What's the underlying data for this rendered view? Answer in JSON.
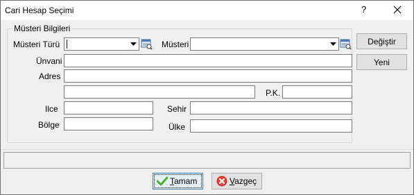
{
  "window": {
    "title": "Cari Hesap Seçimi",
    "help_glyph": "?"
  },
  "group": {
    "title": "Müsteri Bilgileri"
  },
  "fields": {
    "musteri_turu": {
      "label": "Müsteri Türü",
      "value": ""
    },
    "musteri": {
      "label": "Müsteri",
      "value": ""
    },
    "unvani": {
      "label": "Ünvani",
      "value": ""
    },
    "adres": {
      "label": "Adres",
      "value": ""
    },
    "adres2": {
      "value": ""
    },
    "pk": {
      "label": "P.K.",
      "value": ""
    },
    "ilce": {
      "label": "Ilce",
      "value": ""
    },
    "sehir": {
      "label": "Sehir",
      "value": ""
    },
    "bolge": {
      "label": "Bölge",
      "value": ""
    },
    "ulke": {
      "label": "Ülke",
      "value": ""
    }
  },
  "side_buttons": {
    "degistir": "Değiştir",
    "yeni": "Yeni"
  },
  "footer": {
    "ok": {
      "mnemonic": "T",
      "rest": "amam"
    },
    "cancel": {
      "mnemonic": "V",
      "rest": "azgeç"
    }
  },
  "icons": {
    "ok": "check-icon",
    "cancel": "cancel-x-icon",
    "lookup": "lookup-icon",
    "dropdown": "chevron-down-icon",
    "close": "close-icon"
  },
  "colors": {
    "ok_check": "#4caf2a",
    "cancel_circle": "#d9262a"
  }
}
